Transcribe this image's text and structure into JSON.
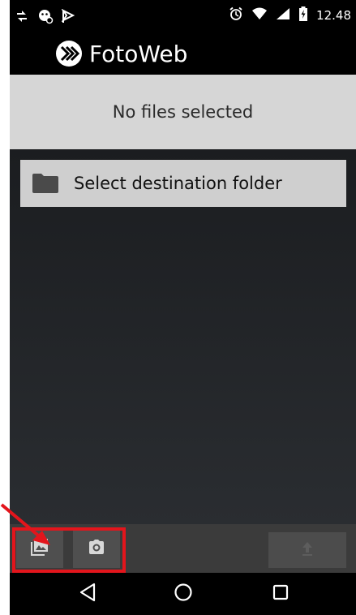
{
  "status_bar": {
    "time": "12.48",
    "left_icons": [
      "usb-sync-icon",
      "android-debug-icon",
      "notification-flag-icon"
    ],
    "right_icons": [
      "alarm-icon",
      "wifi-icon",
      "signal-icon",
      "battery-charging-icon"
    ]
  },
  "app": {
    "title": "FotoWeb",
    "logo_icon": "fotoweb-logo-icon"
  },
  "files_banner": {
    "text": "No files selected"
  },
  "destination": {
    "label": "Select destination folder",
    "icon": "folder-icon"
  },
  "action_bar": {
    "buttons": [
      {
        "name": "gallery-button",
        "icon": "gallery-icon"
      },
      {
        "name": "camera-button",
        "icon": "camera-icon"
      },
      {
        "name": "upload-button",
        "icon": "upload-icon"
      }
    ],
    "highlight_color": "#e3151c"
  },
  "nav_bar": {
    "buttons": [
      "back-icon",
      "home-icon",
      "recents-icon"
    ]
  },
  "colors": {
    "banner_bg": "#d6d6d6",
    "content_bg": "#1b1d20",
    "action_bar_bg": "#3b3b3b",
    "annotation_red": "#e3151c"
  }
}
